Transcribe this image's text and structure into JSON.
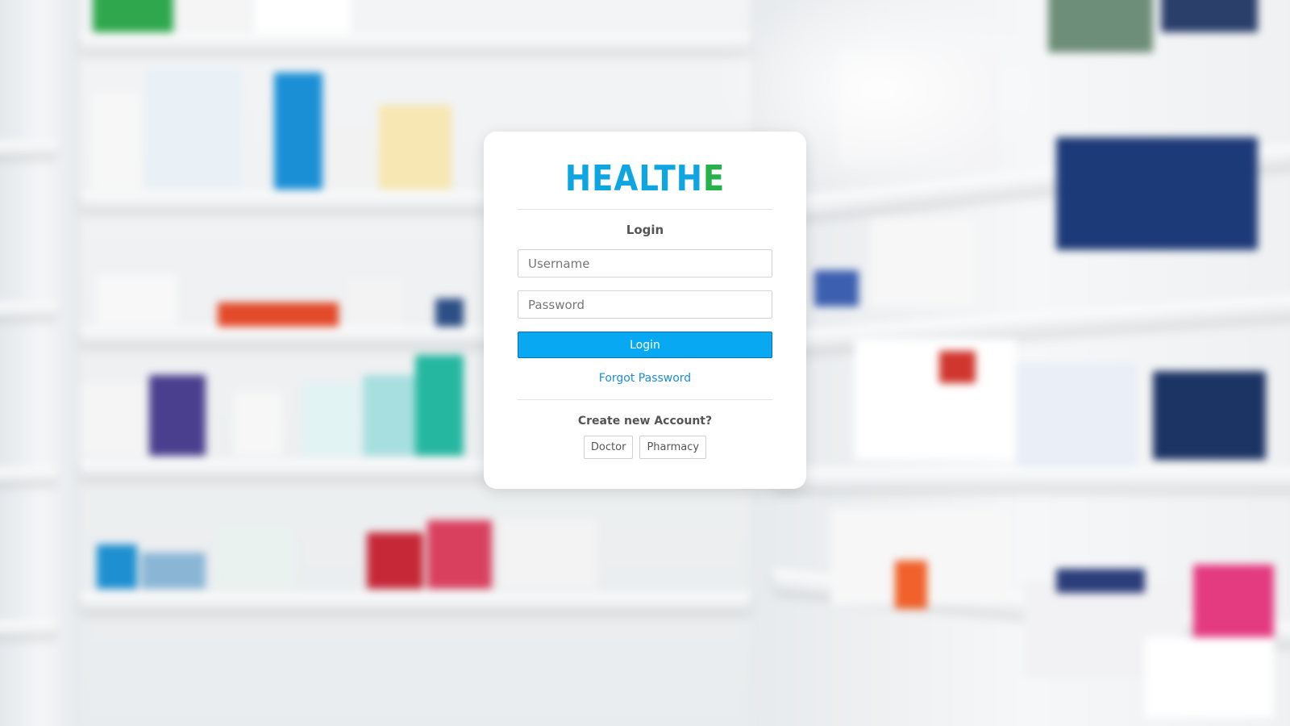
{
  "brand": {
    "logo_part1": "HEALTH",
    "logo_part2": "E",
    "color_blue": "#0ea5e0",
    "color_green": "#25b24a"
  },
  "login": {
    "title": "Login",
    "username_placeholder": "Username",
    "password_placeholder": "Password",
    "submit_label": "Login",
    "forgot_label": "Forgot Password",
    "accent_color": "#08a8f2"
  },
  "register": {
    "title": "Create new Account?",
    "doctor_label": "Doctor",
    "pharmacy_label": "Pharmacy"
  }
}
